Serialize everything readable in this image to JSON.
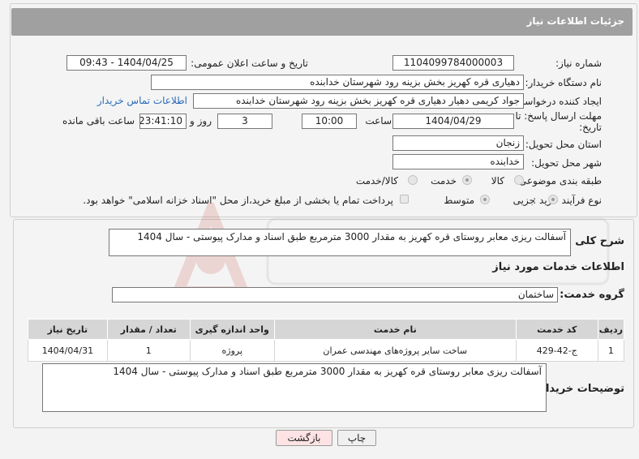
{
  "header": {
    "title": "جزئیات اطلاعات نیاز"
  },
  "fields": {
    "need_number_label": "شماره نیاز:",
    "need_number": "1104099784000003",
    "announce_label": "تاریخ و ساعت اعلان عمومی:",
    "announce_value": "1404/04/25 - 09:43",
    "buyer_org_label": "نام دستگاه خریدار:",
    "buyer_org": "دهیاری قره کهریز بخش بزینه رود شهرستان خدابنده",
    "requester_label": "ایجاد کننده درخواست:",
    "requester": "جواد کریمی دهیار دهیاری قره کهریز بخش بزینه رود شهرستان خدابنده",
    "contact_link": "اطلاعات تماس خریدار",
    "deadline_label_1": "مهلت ارسال پاسخ: تا",
    "deadline_label_2": "تاریخ:",
    "deadline_date": "1404/04/29",
    "time_label": "ساعت",
    "deadline_time": "10:00",
    "days_value": "3",
    "days_label": "روز و",
    "remaining_time": "23:41:10",
    "remaining_label": "ساعت باقی مانده",
    "province_label": "استان محل تحویل:",
    "province": "زنجان",
    "city_label": "شهر محل تحویل:",
    "city": "خدابنده",
    "category_label": "طبقه بندی موضوعی:",
    "category_options": [
      "کالا",
      "خدمت",
      "کالا/خدمت"
    ],
    "category_selected": "خدمت",
    "process_label": "نوع فرآیند خرید :",
    "process_options": [
      "جزیی",
      "متوسط"
    ],
    "process_selected": "جزیی",
    "payment_note": "پرداخت تمام یا بخشی از مبلغ خرید،از محل \"اسناد خزانه اسلامی\" خواهد بود."
  },
  "details": {
    "summary_label": "شرح کلی نیاز:",
    "summary": "آسفالت ریزی معابر روستای قره کهریز به مقدار 3000 مترمربع طبق اسناد و مدارک پیوستی - سال 1404",
    "services_title": "اطلاعات خدمات مورد نیاز",
    "service_group_label": "گروه خدمت:",
    "service_group": "ساختمان",
    "table": {
      "headers": [
        "ردیف",
        "کد خدمت",
        "نام خدمت",
        "واحد اندازه گیری",
        "تعداد / مقدار",
        "تاریخ نیاز"
      ],
      "rows": [
        [
          "1",
          "ج-42-429",
          "ساخت سایر پروژه‌های مهندسی عمران",
          "پروژه",
          "1",
          "1404/04/31"
        ]
      ]
    },
    "buyer_notes_label": "توضیحات خریدار:",
    "buyer_notes": "آسفالت ریزی معابر روستای قره کهریز به مقدار 3000 مترمربع طبق اسناد و مدارک پیوستی - سال 1404"
  },
  "buttons": {
    "print": "چاپ",
    "back": "بازگشت"
  },
  "colors": {
    "header_bg": "#a0a0a0",
    "link": "#2b6cb8",
    "back_btn_bg": "#fde3e3"
  }
}
